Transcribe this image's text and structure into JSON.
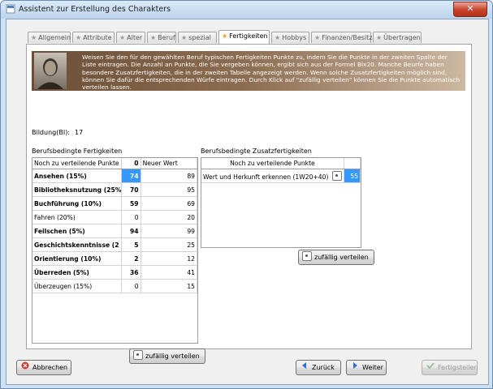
{
  "window": {
    "title": "Assistent zur Erstellung des Charakters",
    "close_label": "✕"
  },
  "tabs": [
    {
      "label": "Allgemein",
      "active": false
    },
    {
      "label": "Attribute",
      "active": false
    },
    {
      "label": "Alter",
      "active": false
    },
    {
      "label": "Beruf",
      "active": false
    },
    {
      "label": "spezial",
      "active": false
    },
    {
      "label": "Fertigkeiten",
      "active": true
    },
    {
      "label": "Hobbys",
      "active": false
    },
    {
      "label": "Finanzen/Besitz",
      "active": false
    },
    {
      "label": "Übertragen",
      "active": false
    }
  ],
  "banner": {
    "text": "Weisen Sie den für den gewählten Beruf typischen Fertigkeiten Punkte zu, indem Sie die Punkte in der zweiten Spalte der Liste eintragen. Die Anzahl an Punkte, die Sie vergeben können, ergibt sich aus der Formel Blx20. Manche Beurfe haben besondere Zusatzfertigkeiten, die in der zweiten Tabelle angezeigt werden. Wenn solche Zusatzfertigkeiten möglich sind, können Sie dafür die entsprechenden Würfe eintragen. Durch Klick auf \"zufällig verteilen\" können Sie die Punkte automatisch verteilen lassen."
  },
  "bildung": {
    "label": "Bildung(BI):",
    "value": "17"
  },
  "skills": {
    "title": "Berufsbedingte Fertigkeiten",
    "header": {
      "name": "Noch zu verteilende Punkte",
      "points": "0",
      "new_value": "Neuer Wert"
    },
    "rows": [
      {
        "name": "Ansehen (15%)",
        "points": "74",
        "new_value": "89",
        "bold": true,
        "selected": true
      },
      {
        "name": "Bibliotheksnutzung (25%",
        "points": "70",
        "new_value": "95",
        "bold": true
      },
      {
        "name": "Buchführung (10%)",
        "points": "59",
        "new_value": "69",
        "bold": true
      },
      {
        "name": "Fahren (20%)",
        "points": "0",
        "new_value": "20",
        "bold": false
      },
      {
        "name": "Feilschen (5%)",
        "points": "94",
        "new_value": "99",
        "bold": true
      },
      {
        "name": "Geschichtskenntnisse (2",
        "points": "5",
        "new_value": "25",
        "bold": true
      },
      {
        "name": "Orientierung (10%)",
        "points": "2",
        "new_value": "12",
        "bold": true
      },
      {
        "name": "Überreden (5%)",
        "points": "36",
        "new_value": "41",
        "bold": true
      },
      {
        "name": "Überzeugen (15%)",
        "points": "0",
        "new_value": "15",
        "bold": false
      }
    ],
    "random_button": "zufällig verteilen"
  },
  "extra_skills": {
    "title": "Berufsbedingte Zusatzfertigkeiten",
    "header": {
      "name": "Noch zu verteilende Punkte",
      "value": ""
    },
    "rows": [
      {
        "name": "Wert und Herkunft erkennen (1W20+40)",
        "value": "55"
      }
    ],
    "random_button": "zufällig verteilen"
  },
  "footer": {
    "cancel": "Abbrechen",
    "back": "Zurück",
    "next": "Weiter",
    "finish": "Fertigstellen"
  },
  "colors": {
    "selection": "#3399ff",
    "cancel_icon": "#d9342b",
    "nav_icon": "#2f6fd6",
    "finish_icon": "#8ab88a"
  }
}
